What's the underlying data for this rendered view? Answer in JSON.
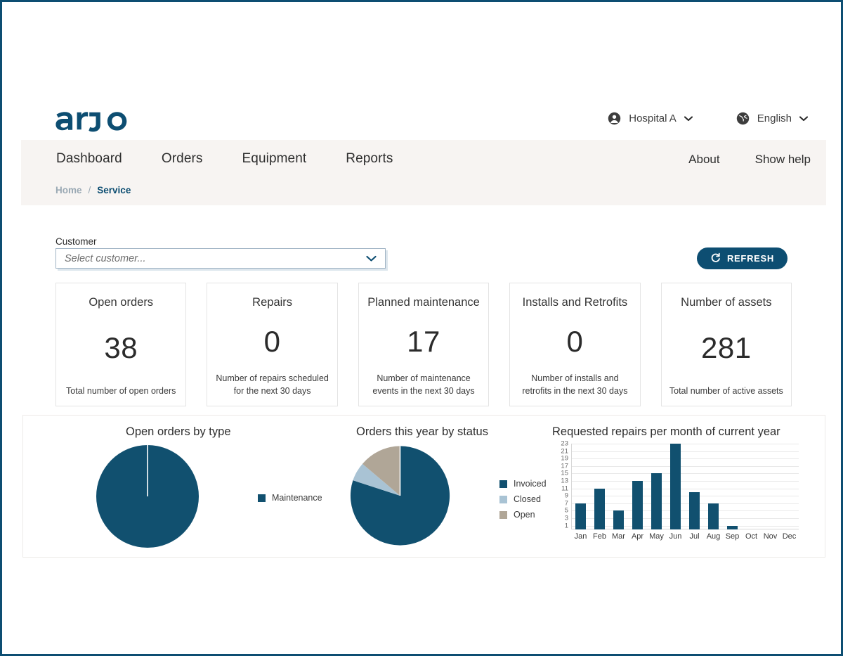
{
  "colors": {
    "brand_blue": "#0d4e72",
    "pie_dark": "#11506f",
    "pie_light": "#a9c3d4",
    "pie_tan": "#b0a697",
    "nav_band": "#f7f4f2",
    "page_border": "#0d4e72"
  },
  "header": {
    "logo_alt": "arjo",
    "account": {
      "icon": "user-circle-icon",
      "label": "Hospital A",
      "caret": "chevron-down-icon"
    },
    "language": {
      "icon": "globe-icon",
      "label": "English",
      "caret": "chevron-down-icon"
    }
  },
  "nav": {
    "items": [
      {
        "label": "Dashboard"
      },
      {
        "label": "Orders"
      },
      {
        "label": "Equipment"
      },
      {
        "label": "Reports"
      }
    ],
    "right_items": [
      {
        "label": "About"
      },
      {
        "label": "Show help"
      }
    ],
    "breadcrumb": {
      "home": "Home",
      "separator": "/",
      "current": "Service"
    }
  },
  "filter": {
    "customer_label": "Customer",
    "customer_placeholder": "Select customer...",
    "customer_value": "",
    "refresh_label": "REFRESH",
    "refresh_icon": "refresh-icon"
  },
  "kpis": [
    {
      "title": "Open orders",
      "value": "38",
      "subtitle": "Total number of open orders"
    },
    {
      "title": "Repairs",
      "value": "0",
      "subtitle": "Number of repairs scheduled for the next 30 days"
    },
    {
      "title": "Planned maintenance",
      "value": "17",
      "subtitle": "Number of maintenance events in the next 30 days"
    },
    {
      "title": "Installs and Retrofits",
      "value": "0",
      "subtitle": "Number of installs and retrofits in the next 30 days"
    },
    {
      "title": "Number of assets",
      "value": "281",
      "subtitle": "Total number of active assets"
    }
  ],
  "chart_data": [
    {
      "type": "pie",
      "title": "Open orders by type",
      "categories": [
        "Maintenance"
      ],
      "values": [
        100
      ],
      "colors": [
        "#11506f"
      ],
      "legend": [
        "Maintenance"
      ],
      "legend_position": "right"
    },
    {
      "type": "pie",
      "title": "Orders this year by status",
      "categories": [
        "Invoiced",
        "Closed",
        "Open"
      ],
      "values": [
        80,
        7,
        13
      ],
      "colors": [
        "#11506f",
        "#a9c3d4",
        "#b0a697"
      ],
      "legend": [
        "Invoiced",
        "Closed",
        "Open"
      ],
      "legend_position": "right"
    },
    {
      "type": "bar",
      "title": "Requested repairs per month of current year",
      "categories": [
        "Jan",
        "Feb",
        "Mar",
        "Apr",
        "May",
        "Jun",
        "Jul",
        "Aug",
        "Sep",
        "Oct",
        "Nov",
        "Dec"
      ],
      "values": [
        7,
        11,
        5,
        13,
        15,
        23,
        10,
        7,
        1,
        0,
        0,
        0
      ],
      "yticks": [
        1,
        3,
        5,
        7,
        9,
        11,
        13,
        15,
        17,
        19,
        21,
        23
      ],
      "ylim": [
        0,
        23
      ],
      "xlabel": "",
      "ylabel": "",
      "grid": true,
      "color": "#11506f"
    }
  ]
}
